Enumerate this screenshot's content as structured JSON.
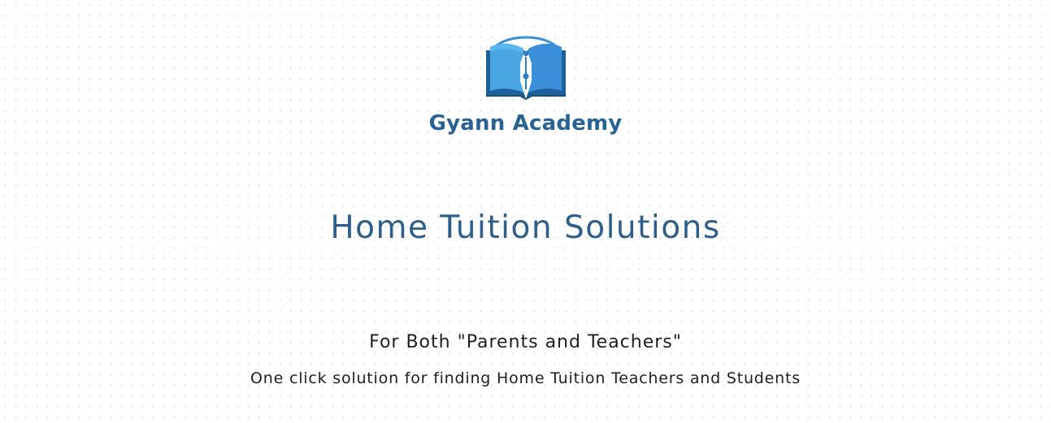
{
  "brand": {
    "name": "Gyann Academy",
    "logo_icon": "open-book-with-pen-nib-icon"
  },
  "hero": {
    "title": "Home Tuition Solutions",
    "subtitle": "For Both \"Parents and Teachers\"",
    "tagline": "One click solution for finding Home Tuition Teachers and Students"
  },
  "colors": {
    "brand_blue": "#2a6293",
    "title_blue": "#2f5f88",
    "book_light": "#4aa6e3",
    "book_dark": "#1f5f9a",
    "arc_blue": "#3b8fd8",
    "text_dark": "#1e1e1e"
  }
}
